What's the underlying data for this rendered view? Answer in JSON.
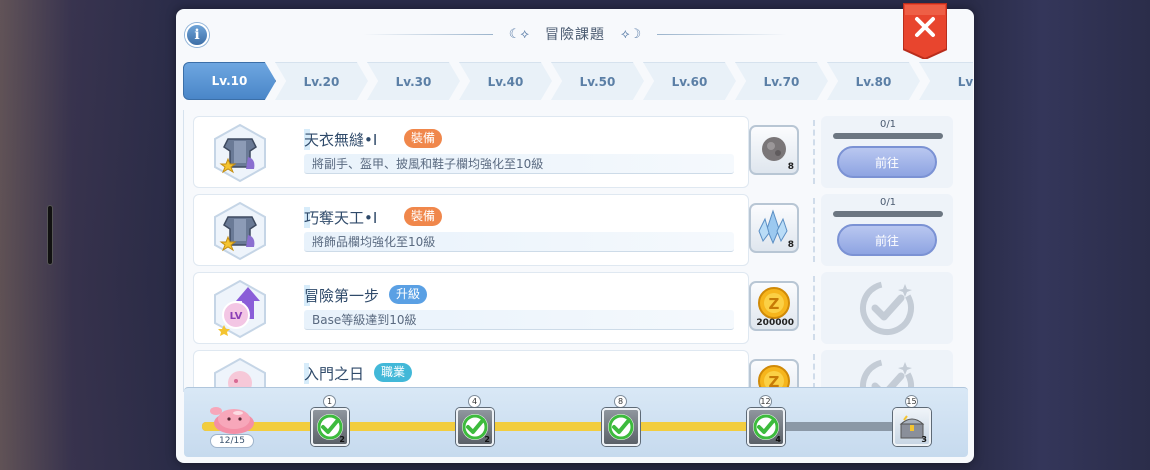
{
  "window": {
    "title": "冒險課題",
    "info_label": "i"
  },
  "tabs": [
    {
      "label": "Lv.10",
      "active": true
    },
    {
      "label": "Lv.20",
      "active": false
    },
    {
      "label": "Lv.30",
      "active": false
    },
    {
      "label": "Lv.40",
      "active": false
    },
    {
      "label": "Lv.50",
      "active": false
    },
    {
      "label": "Lv.60",
      "active": false
    },
    {
      "label": "Lv.70",
      "active": false
    },
    {
      "label": "Lv.80",
      "active": false
    },
    {
      "label": "Lv",
      "active": false
    }
  ],
  "quests": [
    {
      "title": "天衣無縫•I",
      "tag": "裝備",
      "tag_color": "#f0874b",
      "description": "將副手、盔甲、披風和鞋子欄均強化至10級",
      "icon": "armor-icon",
      "reward": {
        "icon": "ore-stone-icon",
        "qty": "8"
      },
      "progress": "0/1",
      "progress_fraction": 0,
      "action_label": "前往",
      "completed": false
    },
    {
      "title": "巧奪天工•I",
      "tag": "裝備",
      "tag_color": "#f0874b",
      "description": "將飾品欄均強化至10級",
      "icon": "armor-icon",
      "reward": {
        "icon": "crystal-icon",
        "qty": "8"
      },
      "progress": "0/1",
      "progress_fraction": 0,
      "action_label": "前往",
      "completed": false
    },
    {
      "title": "冒險第一步",
      "tag": "升級",
      "tag_color": "#5aa0e4",
      "description": "Base等級達到10級",
      "icon": "level-up-icon",
      "reward": {
        "icon": "zeny-coin-icon",
        "qty": "200000"
      },
      "completed": true
    },
    {
      "title": "入門之日",
      "tag": "職業",
      "tag_color": "#42b8d8",
      "description": "",
      "icon": "job-icon",
      "reward": {
        "icon": "zeny-coin-icon",
        "qty": ""
      },
      "completed": true
    }
  ],
  "milestones": {
    "progress_text": "12/15",
    "progress_value": 12,
    "progress_max": 15,
    "items": [
      {
        "threshold": "1",
        "qty": "2",
        "claimed": true,
        "icon": "check-icon"
      },
      {
        "threshold": "4",
        "qty": "2",
        "claimed": true,
        "icon": "check-icon"
      },
      {
        "threshold": "8",
        "qty": "",
        "claimed": true,
        "icon": "check-icon"
      },
      {
        "threshold": "12",
        "qty": "4",
        "claimed": true,
        "icon": "check-icon"
      },
      {
        "threshold": "15",
        "qty": "3",
        "claimed": false,
        "icon": "treasure-chest-icon"
      }
    ]
  },
  "colors": {
    "accent": "#4a86c8",
    "close": "#e8452e",
    "progress_fill": "#f2cd3e",
    "check_green": "#3dbb3d"
  }
}
